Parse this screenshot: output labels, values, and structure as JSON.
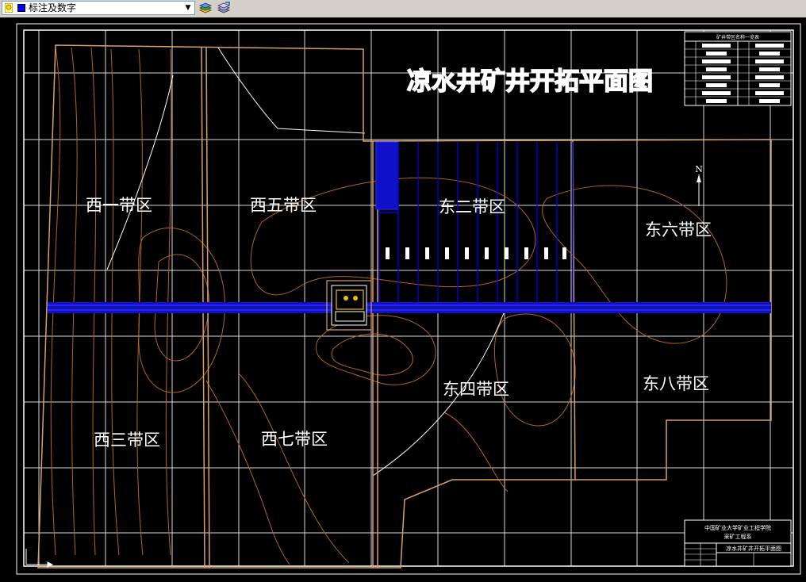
{
  "toolbar": {
    "layer_name": "标注及数字",
    "layer_color": "#0000ff",
    "dropdown_icon": "chevron-down-icon",
    "layer_state_icon": "lightbulb-lock-icon",
    "make_current_icon": "layers-stack-icon",
    "layer_previous_icon": "layer-previous-icon"
  },
  "drawing": {
    "title": "凉水井矿井开拓平面图",
    "table_title": "矿井带区名称一览表",
    "north_label": "N",
    "zones": [
      "西一带区",
      "西五带区",
      "东二带区",
      "东六带区",
      "东四带区",
      "东八带区",
      "西三带区",
      "西七带区"
    ],
    "title_block": {
      "line1": "中国矿业大学矿业工程学院",
      "line2": "采矿工程系",
      "drawing_name": "凉水井矿井开拓平面图"
    }
  },
  "colors": {
    "background": "#000000",
    "grid": "#ffffff",
    "boundary": "#d9a066",
    "contour": "#b5651d",
    "roadway": "#1010c8",
    "panels": "#0000ff",
    "text": "#ffffff"
  }
}
